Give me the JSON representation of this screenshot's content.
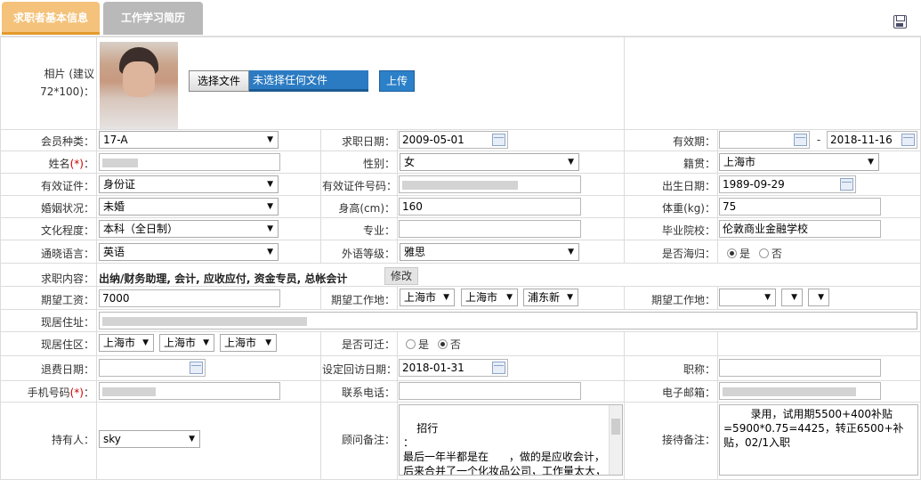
{
  "tabs": {
    "basic": "求职者基本信息",
    "history": "工作学习简历"
  },
  "photo": {
    "label": "相片 (建议72*100)：",
    "choose_file": "选择文件",
    "no_file": "未选择任何文件",
    "upload": "上传"
  },
  "labels": {
    "member_type": "会员种类：",
    "apply_date": "求职日期：",
    "valid_period": "有效期：",
    "name": "姓名",
    "gender": "性别：",
    "native": "籍贯：",
    "id_type": "有效证件：",
    "id_no": "有效证件号码：",
    "birth": "出生日期：",
    "marriage": "婚姻状况：",
    "height": "身高(cm)：",
    "weight": "体重(kg)：",
    "education": "文化程度：",
    "major": "专业：",
    "school": "毕业院校：",
    "language": "通晓语言：",
    "foreign_level": "外语等级：",
    "overseas": "是否海归：",
    "job_content": "求职内容：",
    "salary": "期望工资：",
    "work_place1": "期望工作地：",
    "work_place2": "期望工作地：",
    "address": "现居住址：",
    "district": "现居住区：",
    "relocate": "是否可迁：",
    "refund_date": "退费日期：",
    "visit_date": "设定回访日期：",
    "title": "职称：",
    "mobile": "手机号码",
    "phone": "联系电话：",
    "email": "电子邮箱：",
    "holder": "持有人：",
    "advisor_note": "顾问备注：",
    "reception_note": "接待备注：",
    "required_mark": "(*)",
    "colon": "：",
    "dash": "-"
  },
  "values": {
    "member_type": "17-A",
    "apply_date": "2009-05-01",
    "valid_from": "",
    "valid_to": "2018-11-16",
    "gender": "女",
    "native": "上海市",
    "id_type": "身份证",
    "birth": "1989-09-29",
    "marriage": "未婚",
    "height": "160",
    "weight": "75",
    "education": "本科（全日制）",
    "school": "伦敦商业金融学校",
    "language": "英语",
    "foreign_level": "雅思",
    "yes": "是",
    "no": "否",
    "job_content": "出纳/财务助理, 会计, 应收应付, 资金专员, 总帐会计",
    "edit": "修改",
    "salary": "7000",
    "wp1_prov": "上海市",
    "wp1_city": "上海市",
    "wp1_dist": "浦东新",
    "district_prov": "上海市",
    "district_city": "上海市",
    "district_dist": "上海市",
    "visit_date": "2018-01-31",
    "holder": "sky",
    "advisor_note": "招行\n：\n最后一年半都是在      ，做的是应收会计，后来合并了一个化妆品公司，工作量太大，自己考虑离职，做的是",
    "reception_note": "        录用，试用期5500+400补贴=5900*0.75=4425，转正6500+补贴，02/1入职"
  }
}
